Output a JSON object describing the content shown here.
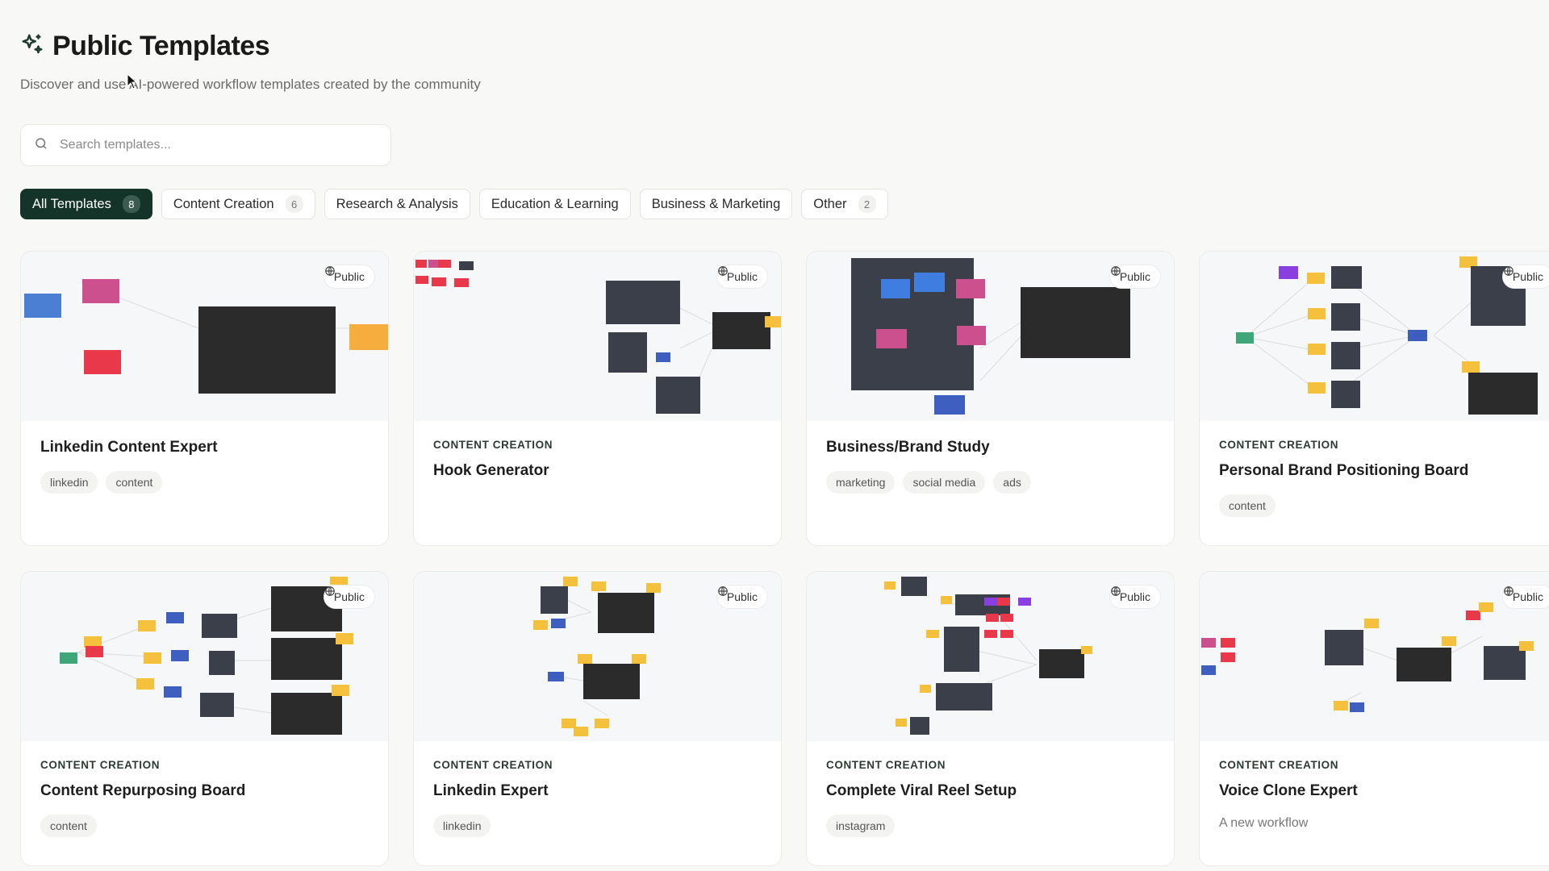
{
  "header": {
    "title": "Public Templates",
    "subtitle": "Discover and use AI-powered workflow templates created by the community"
  },
  "search": {
    "placeholder": "Search templates..."
  },
  "filters": [
    {
      "label": "All Templates",
      "count": "8",
      "active": true
    },
    {
      "label": "Content Creation",
      "count": "6"
    },
    {
      "label": "Research & Analysis"
    },
    {
      "label": "Education & Learning"
    },
    {
      "label": "Business & Marketing"
    },
    {
      "label": "Other",
      "count": "2"
    }
  ],
  "badge_label": "Public",
  "cards": [
    {
      "category": "",
      "title": "Linkedin Content Expert",
      "tags": [
        "linkedin",
        "content"
      ]
    },
    {
      "category": "CONTENT CREATION",
      "title": "Hook Generator",
      "tags": []
    },
    {
      "category": "",
      "title": "Business/Brand Study",
      "tags": [
        "marketing",
        "social media",
        "ads"
      ]
    },
    {
      "category": "CONTENT CREATION",
      "title": "Personal Brand Positioning Board",
      "tags": [
        "content"
      ]
    },
    {
      "category": "CONTENT CREATION",
      "title": "Content Repurposing Board",
      "tags": [
        "content"
      ]
    },
    {
      "category": "CONTENT CREATION",
      "title": "Linkedin Expert",
      "tags": [
        "linkedin"
      ]
    },
    {
      "category": "CONTENT CREATION",
      "title": "Complete Viral Reel Setup",
      "tags": [
        "instagram"
      ]
    },
    {
      "category": "CONTENT CREATION",
      "title": "Voice Clone Expert",
      "tags": [],
      "description": "A new workflow"
    }
  ],
  "colors": {
    "active_chip": "#14342a",
    "node_dark": "#2b2b2b",
    "node_blue": "#4a7fd4",
    "node_yellow": "#f5c13d",
    "node_red": "#e8384a",
    "node_pink": "#cc4f8e",
    "node_green": "#3fa67a"
  }
}
